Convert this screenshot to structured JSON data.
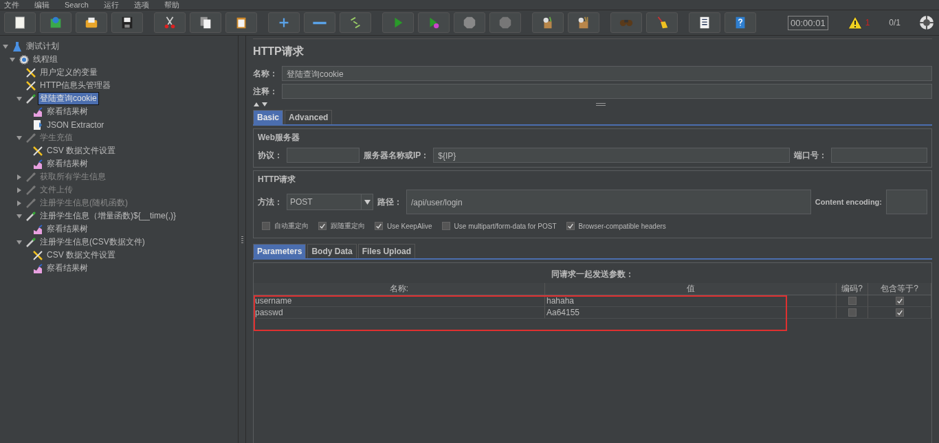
{
  "menu": [
    "文件",
    "编辑",
    "Search",
    "运行",
    "选项",
    "帮助"
  ],
  "toolbar": {
    "timer": "00:00:01",
    "warnings": "1",
    "threads": "0/1"
  },
  "tree": [
    {
      "label": "测试计划",
      "kind": "plan",
      "expanded": true,
      "selected": false,
      "enabled": true,
      "children": [
        {
          "label": "线程组",
          "kind": "threadgroup",
          "expanded": true,
          "selected": false,
          "enabled": true,
          "children": [
            {
              "label": "用户定义的变量",
              "kind": "config",
              "selected": false,
              "enabled": true
            },
            {
              "label": "HTTP信息头管理器",
              "kind": "config",
              "selected": false,
              "enabled": true
            },
            {
              "label": "登陆查询cookie",
              "kind": "sampler",
              "expanded": true,
              "selected": true,
              "enabled": true,
              "children": [
                {
                  "label": "察看结果树",
                  "kind": "listener",
                  "selected": false,
                  "enabled": true
                },
                {
                  "label": "JSON Extractor",
                  "kind": "extractor",
                  "selected": false,
                  "enabled": true
                }
              ]
            },
            {
              "label": "学生充值",
              "kind": "sampler",
              "expanded": true,
              "selected": false,
              "enabled": false,
              "children": [
                {
                  "label": "CSV 数据文件设置",
                  "kind": "config",
                  "selected": false,
                  "enabled": true
                },
                {
                  "label": "察看结果树",
                  "kind": "listener",
                  "selected": false,
                  "enabled": true
                }
              ]
            },
            {
              "label": "获取所有学生信息",
              "kind": "sampler",
              "expanded": false,
              "selected": false,
              "enabled": false
            },
            {
              "label": "文件上传",
              "kind": "sampler",
              "expanded": false,
              "selected": false,
              "enabled": false
            },
            {
              "label": "注册学生信息(随机函数)",
              "kind": "sampler",
              "expanded": false,
              "selected": false,
              "enabled": false
            },
            {
              "label": "注册学生信息（增量函数)${__time(,)}",
              "kind": "sampler",
              "expanded": true,
              "selected": false,
              "enabled": true,
              "children": [
                {
                  "label": "察看结果树",
                  "kind": "listener",
                  "selected": false,
                  "enabled": true
                }
              ]
            },
            {
              "label": "注册学生信息(CSV数据文件)",
              "kind": "sampler",
              "expanded": true,
              "selected": false,
              "enabled": true,
              "children": [
                {
                  "label": "CSV 数据文件设置",
                  "kind": "config",
                  "selected": false,
                  "enabled": true
                },
                {
                  "label": "察看结果树",
                  "kind": "listener",
                  "selected": false,
                  "enabled": true
                }
              ]
            }
          ]
        }
      ]
    }
  ],
  "panel": {
    "title": "HTTP请求",
    "name_label": "名称：",
    "name_value": "登陆查询cookie",
    "comment_label": "注释：",
    "tabs": [
      {
        "label": "Basic",
        "selected": true
      },
      {
        "label": "Advanced",
        "selected": false
      }
    ],
    "web_server": {
      "legend": "Web服务器",
      "protocol_label": "协议：",
      "server_label": "服务器名称或IP：",
      "server_value": "${IP}",
      "port_label": "端口号："
    },
    "http_request": {
      "legend": "HTTP请求",
      "method_label": "方法：",
      "method_value": "POST",
      "path_label": "路径：",
      "path_value": "/api/user/login",
      "encoding_label": "Content encoding:",
      "options": [
        {
          "label": "自动重定向",
          "checked": false
        },
        {
          "label": "跟随重定向",
          "checked": true
        },
        {
          "label": "Use KeepAlive",
          "checked": true
        },
        {
          "label": "Use multipart/form-data for POST",
          "checked": false
        },
        {
          "label": "Browser-compatible headers",
          "checked": true
        }
      ]
    },
    "param_tabs": [
      {
        "label": "Parameters",
        "selected": true
      },
      {
        "label": "Body Data",
        "selected": false
      },
      {
        "label": "Files Upload",
        "selected": false
      }
    ],
    "params": {
      "caption": "同请求一起发送参数：",
      "columns": [
        "名称:",
        "值",
        "编码?",
        "包含等于?"
      ],
      "rows": [
        {
          "name": "username",
          "value": "hahaha",
          "encode": false,
          "include_equals": true
        },
        {
          "name": "passwd",
          "value": "Aa64155",
          "encode": false,
          "include_equals": true
        }
      ]
    }
  }
}
